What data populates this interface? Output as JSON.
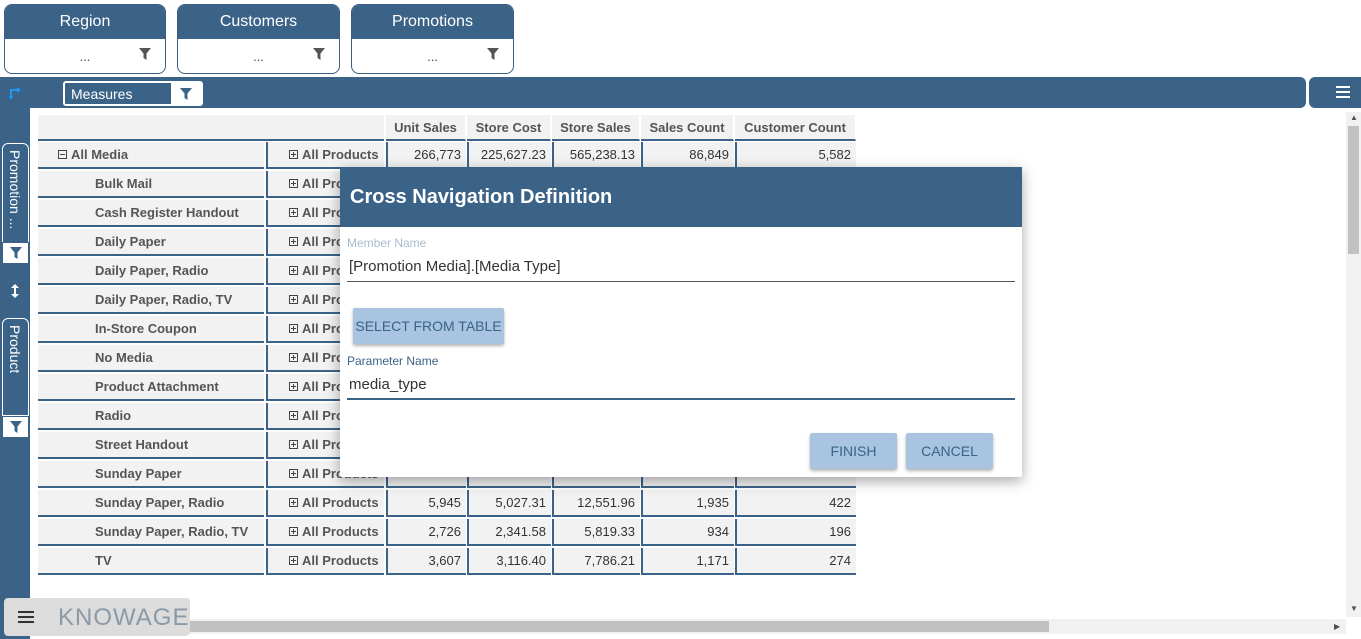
{
  "filters": [
    {
      "title": "Region",
      "value": "..."
    },
    {
      "title": "Customers",
      "value": "..."
    },
    {
      "title": "Promotions",
      "value": "..."
    }
  ],
  "toolbar": {
    "measures_label": "Measures"
  },
  "rail": {
    "rows_axis": "Promotion ...",
    "columns_axis": "Product"
  },
  "table": {
    "columns": [
      "Unit Sales",
      "Store Cost",
      "Store Sales",
      "Sales Count",
      "Customer Count"
    ],
    "rows": [
      {
        "label": "All Media",
        "product": "All Products",
        "values": [
          "266,773",
          "225,627.23",
          "565,238.13",
          "86,849",
          "5,582"
        ]
      },
      {
        "label": "Bulk Mail",
        "product": "All Products",
        "values": [
          "",
          "",
          "",
          "",
          ""
        ]
      },
      {
        "label": "Cash Register Handout",
        "product": "All Products",
        "values": [
          "",
          "",
          "",
          "",
          ""
        ]
      },
      {
        "label": "Daily Paper",
        "product": "All Products",
        "values": [
          "",
          "",
          "",
          "",
          ""
        ]
      },
      {
        "label": "Daily Paper, Radio",
        "product": "All Products",
        "values": [
          "",
          "",
          "",
          "",
          ""
        ]
      },
      {
        "label": "Daily Paper, Radio, TV",
        "product": "All Products",
        "values": [
          "",
          "",
          "",
          "",
          ""
        ]
      },
      {
        "label": "In-Store Coupon",
        "product": "All Products",
        "values": [
          "",
          "",
          "",
          "",
          ""
        ]
      },
      {
        "label": "No Media",
        "product": "All Products",
        "values": [
          "",
          "",
          "",
          "",
          ""
        ]
      },
      {
        "label": "Product Attachment",
        "product": "All Products",
        "values": [
          "",
          "",
          "",
          "",
          ""
        ]
      },
      {
        "label": "Radio",
        "product": "All Products",
        "values": [
          "",
          "",
          "",
          "",
          ""
        ]
      },
      {
        "label": "Street Handout",
        "product": "All Products",
        "values": [
          "",
          "",
          "",
          "",
          ""
        ]
      },
      {
        "label": "Sunday Paper",
        "product": "All Products",
        "values": [
          "",
          "",
          "",
          "",
          ""
        ]
      },
      {
        "label": "Sunday Paper, Radio",
        "product": "All Products",
        "values": [
          "5,945",
          "5,027.31",
          "12,551.96",
          "1,935",
          "422"
        ]
      },
      {
        "label": "Sunday Paper, Radio, TV",
        "product": "All Products",
        "values": [
          "2,726",
          "2,341.58",
          "5,819.33",
          "934",
          "196"
        ]
      },
      {
        "label": "TV",
        "product": "All Products",
        "values": [
          "3,607",
          "3,116.40",
          "7,786.21",
          "1,171",
          "274"
        ]
      }
    ]
  },
  "dialog": {
    "title": "Cross Navigation Definition",
    "member_label": "Member Name",
    "member_value": "[Promotion Media].[Media Type]",
    "select_button": "SELECT FROM TABLE",
    "param_label": "Parameter Name",
    "param_value": "media_type",
    "finish_button": "FINISH",
    "cancel_button": "CANCEL"
  },
  "logo": {
    "text": "KNOWAGE"
  },
  "colors": {
    "primary": "#3b6388",
    "button_bg": "#a8c4e0",
    "label_member": "#a8c4e0"
  }
}
